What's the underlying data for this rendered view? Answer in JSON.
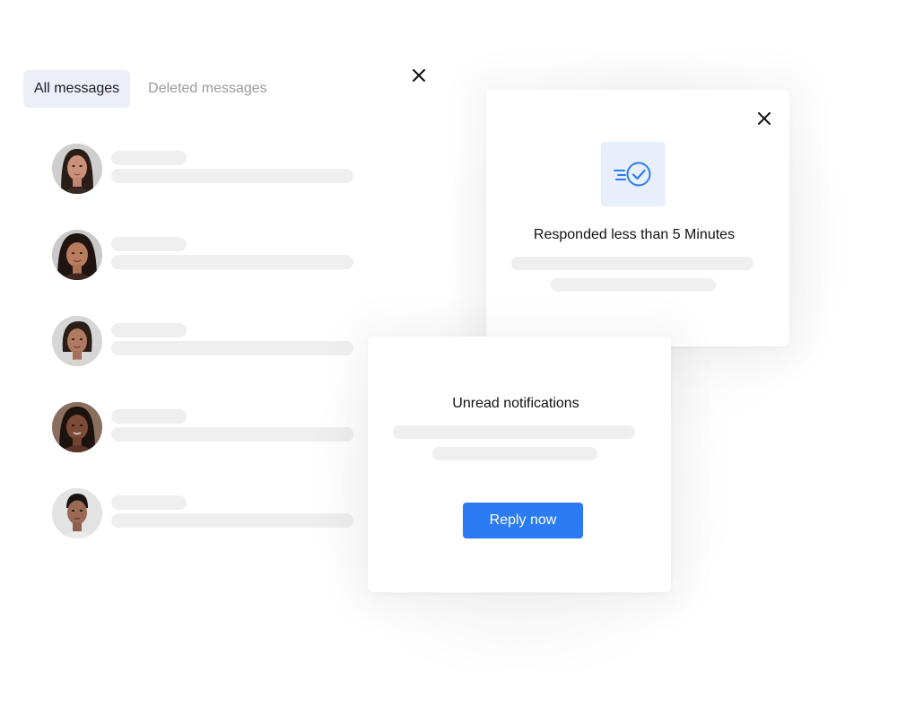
{
  "tabs": {
    "all_messages": "All messages",
    "deleted_messages": "Deleted messages"
  },
  "messages": [
    {
      "avatar": "avatar-woman-1"
    },
    {
      "avatar": "avatar-woman-2"
    },
    {
      "avatar": "avatar-woman-3"
    },
    {
      "avatar": "avatar-woman-4"
    },
    {
      "avatar": "avatar-man-1"
    }
  ],
  "response_card": {
    "icon": "fast-check-icon",
    "title": "Responded less than 5 Minutes"
  },
  "notification_card": {
    "title": "Unread notifications",
    "reply_label": "Reply now"
  },
  "colors": {
    "accent": "#2b7bf5",
    "tab_active_bg": "#eceff8",
    "badge_bg": "#e8effb",
    "skeleton": "#efefef"
  }
}
